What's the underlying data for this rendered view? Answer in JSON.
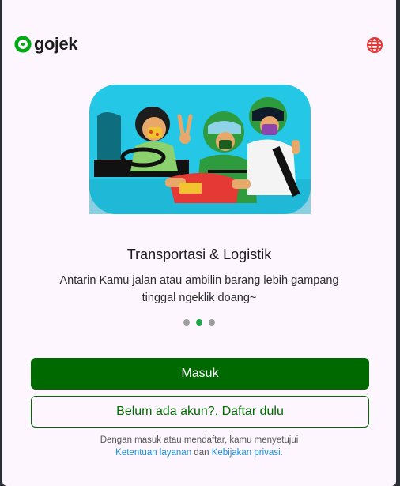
{
  "brand": {
    "name": "gojek",
    "primary_color": "#006a00",
    "logo_color": "#00aa13"
  },
  "header": {
    "language_icon": "globe-icon"
  },
  "slide": {
    "title": "Transportasi & Logistik",
    "description": "Antarin Kamu jalan atau ambilin barang lebih gampang tinggal ngeklik doang~",
    "illustration": "motorbike-riders-illustration"
  },
  "carousel": {
    "total": 3,
    "active_index": 1
  },
  "buttons": {
    "login_label": "Masuk",
    "signup_label": "Belum ada akun?, Daftar dulu"
  },
  "terms": {
    "prefix": "Dengan masuk atau mendaftar, kamu menyetujui",
    "terms_link": "Ketentuan layanan",
    "conjunction": "dan",
    "privacy_link": "Kebijakan privasi."
  }
}
